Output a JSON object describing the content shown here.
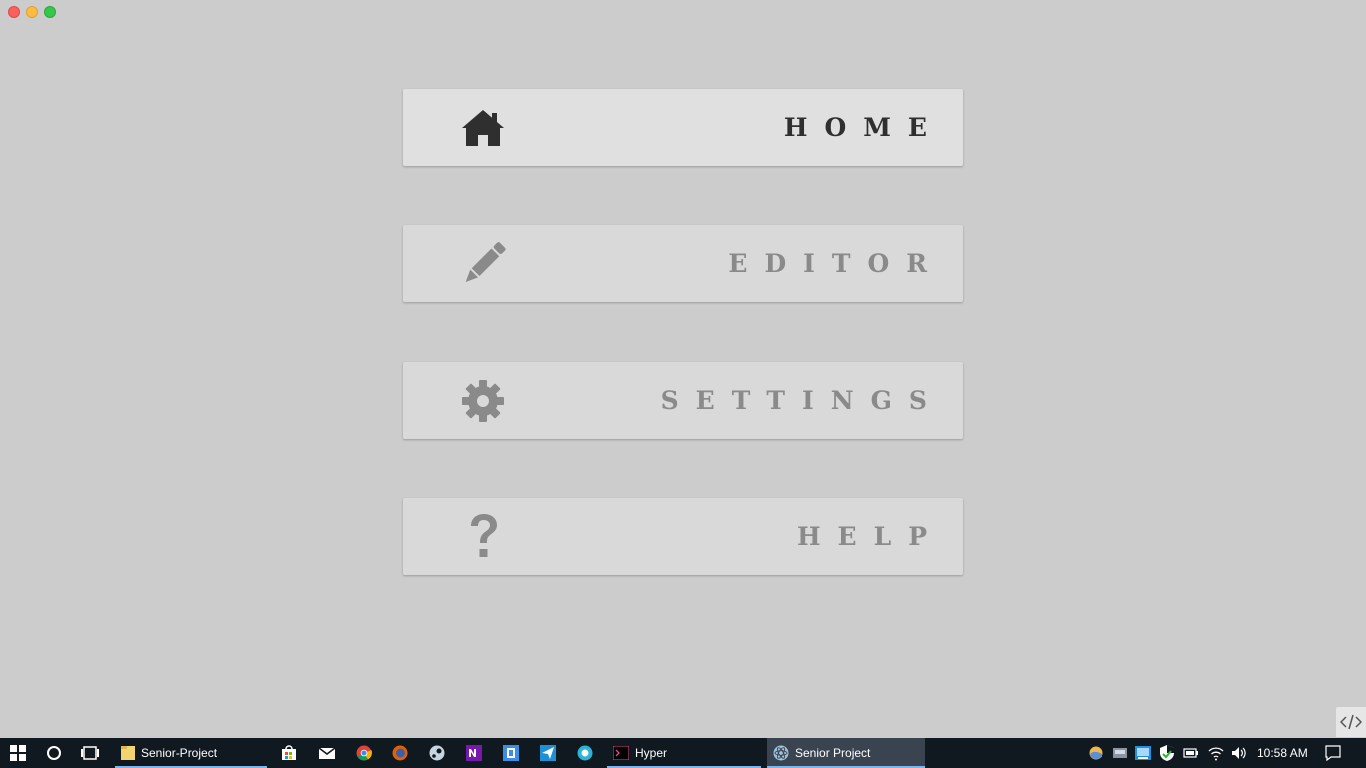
{
  "menu": {
    "items": [
      {
        "label": "HOME",
        "icon": "home-icon",
        "active": true
      },
      {
        "label": "EDITOR",
        "icon": "pencil-icon",
        "active": false
      },
      {
        "label": "SETTINGS",
        "icon": "gear-icon",
        "active": false
      },
      {
        "label": "HELP",
        "icon": "question-mark-icon",
        "active": false
      }
    ]
  },
  "colors": {
    "background": "#cccccc",
    "card": "#d9d9d9",
    "card_active": "#e0e0e0",
    "label_active": "#2f2f2f",
    "label_inactive": "#8a8a8a",
    "taskbar": "#101820",
    "taskbar_accent": "#7eb4ea"
  },
  "taskbar": {
    "apps": [
      {
        "label": "Senior-Project",
        "icon": "folder-icon"
      },
      {
        "label": "Hyper",
        "icon": "terminal-icon"
      },
      {
        "label": "Senior Project",
        "icon": "electron-app-icon"
      }
    ],
    "pinned_icons": [
      "store-icon",
      "mail-icon",
      "chrome-icon",
      "firefox-icon",
      "steam-icon",
      "onenote-icon",
      "app-icon",
      "paper-plane-icon",
      "circle-app-icon"
    ],
    "tray_icons": [
      "weather-icon",
      "drive-icon",
      "network-monitor-icon",
      "defender-icon",
      "battery-icon",
      "wifi-icon",
      "volume-icon"
    ],
    "time": "10:58 AM"
  }
}
